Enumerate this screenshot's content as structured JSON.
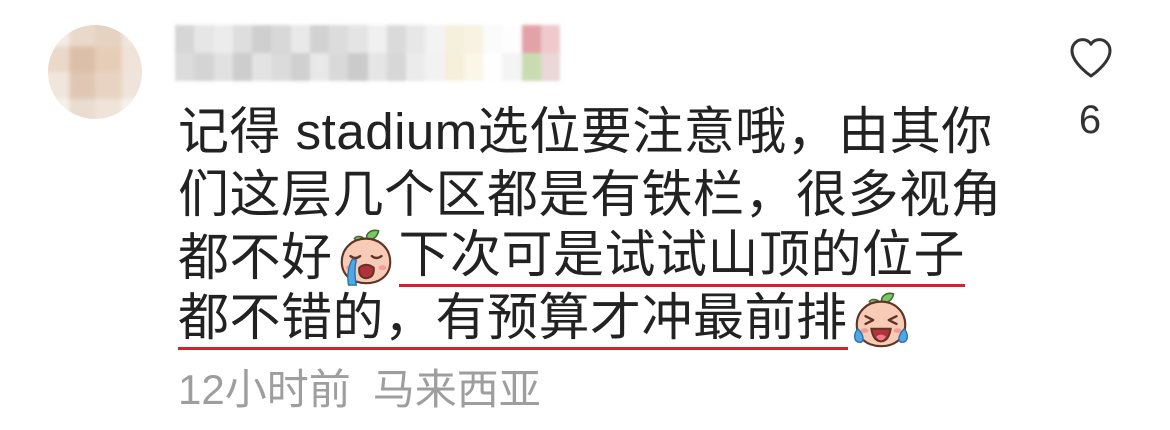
{
  "comment": {
    "lines": [
      {
        "text": "记得 stadium选位要注意哦，由其你"
      },
      {
        "text": "们这层几个区都是有铁栏，很多视角"
      },
      {
        "text": "都不好",
        "emoji": "crying-face-emoji",
        "underlined_text": "下次可是试试山顶的位子"
      },
      {
        "underlined_text": "都不错的，有预算才冲最前排",
        "emoji": "laughing-with-tears-emoji"
      }
    ],
    "time": "12小时前",
    "location": "马来西亚"
  },
  "like": {
    "icon": "heart-outline-icon",
    "count": "6"
  },
  "colors": {
    "text": "#222222",
    "meta_text": "#9e9e9e",
    "underline": "#d4212e",
    "icon": "#333333"
  }
}
